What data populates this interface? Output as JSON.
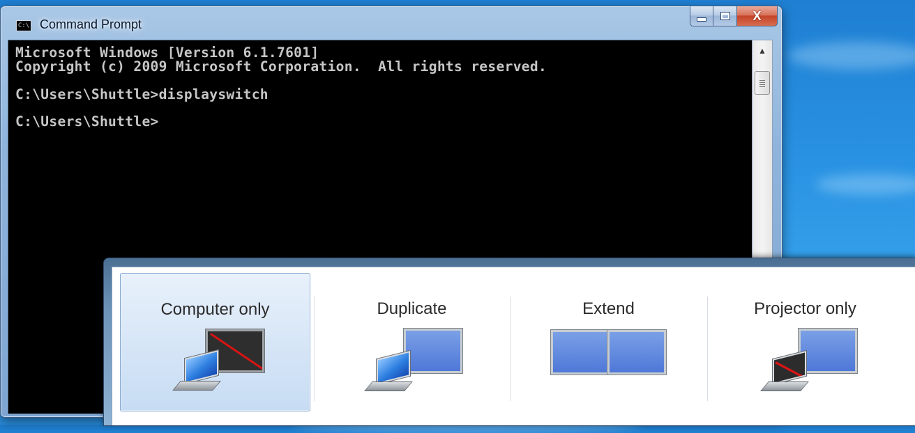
{
  "window": {
    "title": "Command Prompt",
    "icon_text": "C:\\",
    "close_glyph": "X"
  },
  "console": {
    "lines": [
      "Microsoft Windows [Version 6.1.7601]",
      "Copyright (c) 2009 Microsoft Corporation.  All rights reserved.",
      "C:\\Users\\Shuttle>displayswitch",
      "C:\\Users\\Shuttle>"
    ]
  },
  "display_switch": {
    "options": [
      {
        "label": "Computer only",
        "selected": true
      },
      {
        "label": "Duplicate",
        "selected": false
      },
      {
        "label": "Extend",
        "selected": false
      },
      {
        "label": "Projector only",
        "selected": false
      }
    ]
  },
  "colors": {
    "console_bg": "#000000",
    "console_text": "#c6c6c6",
    "monitor_blue": "#4f78d8",
    "selection": "#d7e6f7",
    "disabled_line": "#d81414"
  }
}
